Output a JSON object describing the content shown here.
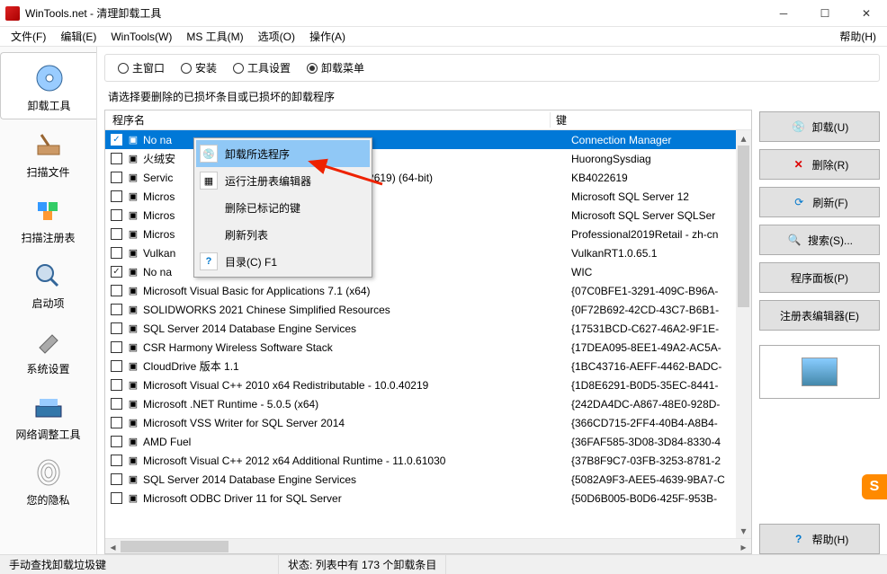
{
  "window": {
    "title": "WinTools.net - 清理卸载工具"
  },
  "menu": {
    "file": "文件(F)",
    "edit": "编辑(E)",
    "wintools": "WinTools(W)",
    "mstools": "MS 工具(M)",
    "options": "选项(O)",
    "actions": "操作(A)",
    "help": "帮助(H)"
  },
  "sidebar": [
    {
      "label": "卸载工具"
    },
    {
      "label": "扫描文件"
    },
    {
      "label": "扫描注册表"
    },
    {
      "label": "启动项"
    },
    {
      "label": "系统设置"
    },
    {
      "label": "网络调整工具"
    },
    {
      "label": "您的隐私"
    }
  ],
  "tabs": {
    "main": "主窗口",
    "install": "安装",
    "toolset": "工具设置",
    "uninstmenu": "卸载菜单"
  },
  "instruction": "请选择要删除的已损坏条目或已损坏的卸载程序",
  "list_header": {
    "program": "程序名",
    "key": "键"
  },
  "rows": [
    {
      "checked": true,
      "sel": true,
      "name": "No na",
      "key": "Connection Manager"
    },
    {
      "checked": false,
      "name": "火绒安",
      "key": "HuorongSysdiag"
    },
    {
      "checked": false,
      "name": "Servic",
      "keyExtra": "22619) (64-bit)",
      "key": "KB4022619"
    },
    {
      "checked": false,
      "name": "Micros",
      "key": "Microsoft SQL Server 12"
    },
    {
      "checked": false,
      "name": "Micros",
      "key": "Microsoft SQL Server SQLSer"
    },
    {
      "checked": false,
      "name": "Micros",
      "key": "Professional2019Retail - zh-cn"
    },
    {
      "checked": false,
      "name": "Vulkan",
      "key": "VulkanRT1.0.65.1"
    },
    {
      "checked": true,
      "name": "No na",
      "key": "WIC"
    },
    {
      "checked": false,
      "name": "Microsoft Visual Basic for Applications 7.1 (x64)",
      "key": "{07C0BFE1-3291-409C-B96A-"
    },
    {
      "checked": false,
      "name": "SOLIDWORKS 2021 Chinese Simplified Resources",
      "key": "{0F72B692-42CD-43C7-B6B1-"
    },
    {
      "checked": false,
      "name": "SQL Server 2014 Database Engine Services",
      "key": "{17531BCD-C627-46A2-9F1E-"
    },
    {
      "checked": false,
      "name": "CSR Harmony Wireless Software Stack",
      "key": "{17DEA095-8EE1-49A2-AC5A-"
    },
    {
      "checked": false,
      "name": "CloudDrive 版本 1.1",
      "key": "{1BC43716-AEFF-4462-BADC-"
    },
    {
      "checked": false,
      "name": "Microsoft Visual C++ 2010  x64 Redistributable - 10.0.40219",
      "key": "{1D8E6291-B0D5-35EC-8441-"
    },
    {
      "checked": false,
      "name": "Microsoft .NET Runtime - 5.0.5 (x64)",
      "key": "{242DA4DC-A867-48E0-928D-"
    },
    {
      "checked": false,
      "name": "Microsoft VSS Writer for SQL Server 2014",
      "key": "{366CD715-2FF4-40B4-A8B4-"
    },
    {
      "checked": false,
      "name": "AMD Fuel",
      "key": "{36FAF585-3D08-3D84-8330-4"
    },
    {
      "checked": false,
      "name": "Microsoft Visual C++ 2012 x64 Additional Runtime - 11.0.61030",
      "key": "{37B8F9C7-03FB-3253-8781-2"
    },
    {
      "checked": false,
      "name": "SQL Server 2014 Database Engine Services",
      "key": "{5082A9F3-AEE5-4639-9BA7-C"
    },
    {
      "checked": false,
      "name": "Microsoft ODBC Driver 11 for SQL Server",
      "key": "{50D6B005-B0D6-425F-953B-"
    }
  ],
  "ctx": {
    "uninstall_selected": "卸载所选程序",
    "run_regedit": "运行注册表编辑器",
    "delete_marked": "删除已标记的键",
    "refresh_list": "刷新列表",
    "catalog": "目录(C)  F1"
  },
  "buttons": {
    "uninstall": "卸载(U)",
    "delete": "删除(R)",
    "refresh": "刷新(F)",
    "search": "搜索(S)...",
    "panel": "程序面板(P)",
    "regedit": "注册表编辑器(E)",
    "help": "帮助(H)"
  },
  "status": {
    "left": "手动查找卸载垃圾键",
    "right": "状态: 列表中有 173 个卸载条目"
  },
  "badge": "S"
}
